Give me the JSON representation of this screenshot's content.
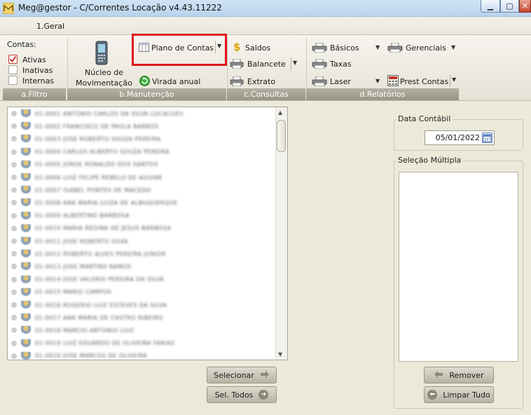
{
  "window": {
    "title": "Meg@gestor - C/Correntes Locação v4.43.11222",
    "controls": {
      "minimize": "▁",
      "maximize": "▢",
      "close": "✕"
    }
  },
  "tabs": [
    {
      "label": "1.Geral"
    }
  ],
  "ribbon": {
    "filtro": {
      "caption": "a.Filtro",
      "title": "Contas:",
      "options": [
        {
          "label": "Ativas",
          "checked": true
        },
        {
          "label": "Inativas",
          "checked": false
        },
        {
          "label": "Internas",
          "checked": false
        }
      ]
    },
    "manutencao": {
      "caption": "b.Manutenção",
      "nucleo_line1": "Núcleo de",
      "nucleo_line2": "Movimentação",
      "plano_contas": "Plano de Contas",
      "virada_anual": "Virada anual"
    },
    "consultas": {
      "caption": "c.Consultas",
      "saldos": "Saldos",
      "balancete": "Balancete",
      "extrato": "Extrato"
    },
    "relatorios": {
      "caption": "d.Relatórios",
      "basicos": "Básicos",
      "taxas": "Taxas",
      "laser": "Laser",
      "gerenciais": "Gerenciais",
      "prest_contas": "Prest Contas"
    }
  },
  "account_list": {
    "rows": [
      "01-0001 ANTONIO CARLOS DA SILVA LOCACOES",
      "01-0002 FRANCISCO DE PAULA BARROS",
      "01-0003 JOSE ROBERTO SOUZA PEREIRA",
      "01-0004 CARLOS ALBERTO SOUZA PEREIRA",
      "01-0005 JORGE RONALDO DOS SANTOS",
      "01-0006 LUIZ FELIPE REBELO DE AGUIAR",
      "01-0007 ISABEL PONTES DE MACEDO",
      "01-0008 ANA MARIA LUIZA DE ALBUQUERQUE",
      "01-0009 ALBERTINO BARBOSA",
      "01-0010 MARIA REGINA DE JESUS BARBOSA",
      "01-0011 JOSE ROBERTO SILVA",
      "01-0012 ROBERTO ALVES PEREIRA JUNIOR",
      "01-0013 JOSE MARTINS RAMOS",
      "01-0014 JOSE VALERIO PEREIRA DA SILVA",
      "01-0015 MARIO CAMPOS",
      "01-0016 ROGERIO LUIZ ESTEVES DA SILVA",
      "01-0017 ANA MARIA DE CASTRO RIBEIRO",
      "01-0018 MARCIO ANTONIO LUIZ",
      "01-0019 LUIZ EDUARDO DE OLIVEIRA FARIAS",
      "01-0020 JOSE MARCOS DE OLIVEIRA"
    ]
  },
  "buttons": {
    "selecionar": "Selecionar",
    "sel_todos": "Sel. Todos",
    "remover": "Remover",
    "limpar_tudo": "Limpar Tudo"
  },
  "right_panel": {
    "data_contabil_label": "Data Contábil",
    "data_contabil_value": "05/01/2022",
    "selecao_multipla_label": "Seleção Múltipla"
  },
  "colors": {
    "highlight": "#e0141c",
    "accent_green": "#2e9b2e"
  }
}
